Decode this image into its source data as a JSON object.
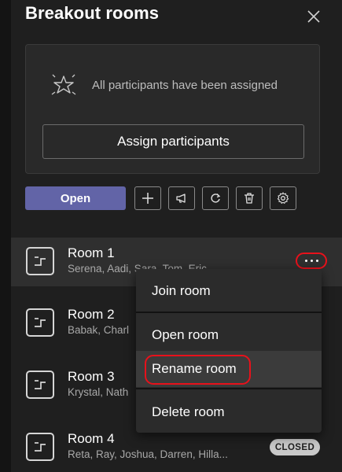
{
  "panel": {
    "title": "Breakout rooms",
    "assigned_message": "All participants have been assigned",
    "assign_button_label": "Assign participants",
    "open_button_label": "Open"
  },
  "toolbar": {
    "tools": [
      "plus-icon",
      "megaphone-icon",
      "refresh-icon",
      "trash-icon",
      "gear-icon"
    ]
  },
  "rooms": [
    {
      "name": "Room 1",
      "members": "Serena, Aadi, Sara, Tom, Eric"
    },
    {
      "name": "Room 2",
      "members": "Babak, Charl"
    },
    {
      "name": "Room 3",
      "members": "Krystal, Nath"
    },
    {
      "name": "Room 4",
      "members": "Reta, Ray, Joshua, Darren, Hilla...",
      "status": "CLOSED"
    }
  ],
  "context_menu": {
    "items": [
      "Join room",
      "Open room",
      "Rename room",
      "Delete room"
    ]
  },
  "colors": {
    "background": "#1f1f1f",
    "accent": "#6264a7",
    "highlight_outline": "#e8111b"
  }
}
